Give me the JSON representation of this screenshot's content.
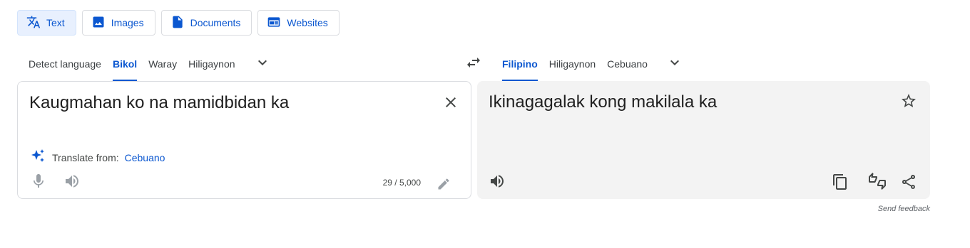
{
  "mode_tabs": {
    "text": "Text",
    "images": "Images",
    "documents": "Documents",
    "websites": "Websites"
  },
  "source_languages": {
    "detect": "Detect language",
    "items": [
      "Bikol",
      "Waray",
      "Hiligaynon"
    ],
    "selected": "Bikol"
  },
  "target_languages": {
    "items": [
      "Filipino",
      "Hiligaynon",
      "Cebuano"
    ],
    "selected": "Filipino"
  },
  "source_panel": {
    "text": "Kaugmahan ko na mamidbidan ka",
    "suggestion_prefix": "Translate from:",
    "suggestion_language": "Cebuano",
    "char_count": "29 / 5,000"
  },
  "target_panel": {
    "text": "Ikinagagalak kong makilala ka"
  },
  "footer": {
    "send_feedback": "Send feedback"
  },
  "colors": {
    "accent": "#0b57d0",
    "active_tab_bg": "#e8f0fe",
    "target_panel_bg": "#f3f3f3"
  },
  "icons": {
    "text_tab": "translate-icon",
    "images_tab": "image-icon",
    "documents_tab": "document-icon",
    "websites_tab": "website-icon",
    "swap": "swap-icon",
    "more": "chevron-down-icon",
    "clear": "close-icon",
    "suggest": "sparkle-icon",
    "mic": "mic-icon",
    "listen": "speaker-icon",
    "edit": "pencil-icon",
    "star": "star-icon",
    "copy": "copy-icon",
    "rate": "thumbs-up-down-icon",
    "share": "share-icon"
  }
}
